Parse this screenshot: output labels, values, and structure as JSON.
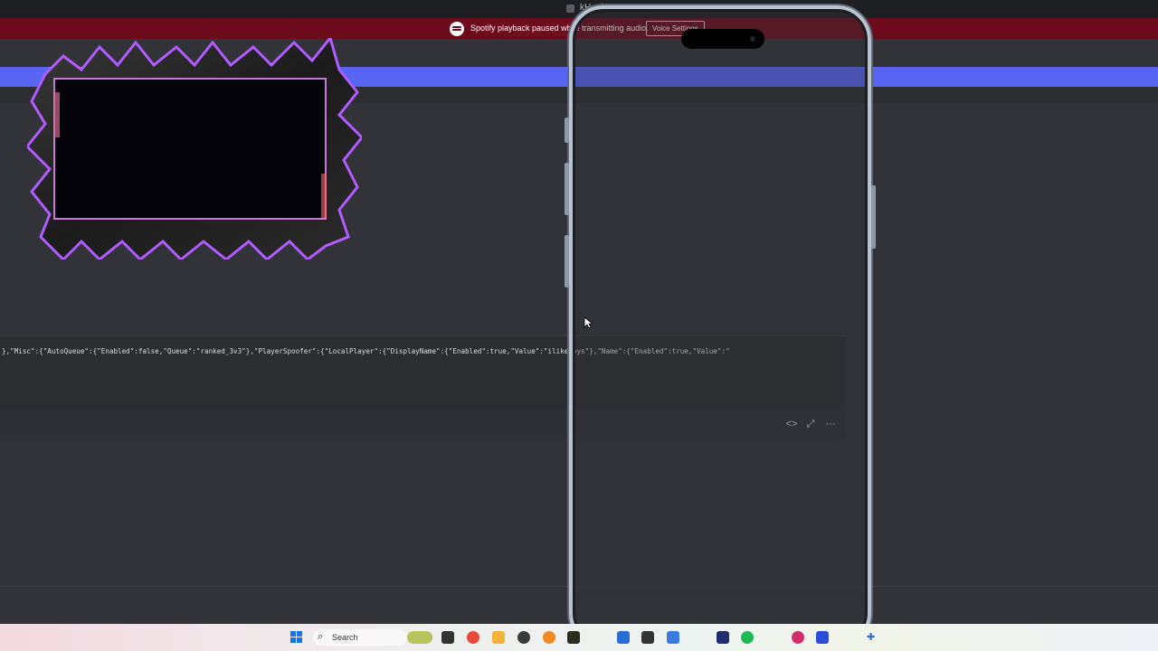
{
  "window": {
    "title": "kHook",
    "app_icon": "app-icon"
  },
  "notice": {
    "icon": "spotify-icon",
    "message": "Spotify playback paused while transmitting audio.",
    "button_label": "Voice Settings"
  },
  "message": {
    "code_text": "},\"Misc\":{\"AutoQueue\":{\"Enabled\":false,\"Queue\":\"ranked_3v3\"},\"PlayerSpoofer\":{\"LocalPlayer\":{\"DisplayName\":{\"Enabled\":true,\"Value\":\"ilikeboys\"},\"Name\":{\"Enabled\":true,\"Value\":\""
  },
  "embed_actions": [
    {
      "icon": "code-icon",
      "glyph": "<>"
    },
    {
      "icon": "expand-icon",
      "glyph": "⤢"
    },
    {
      "icon": "more-icon",
      "glyph": "···"
    }
  ],
  "taskbar": {
    "search_label": "Search",
    "search_icon": "search-icon",
    "apps": [
      "start-icon",
      "widgets-icon",
      "file-icon",
      "chrome-icon",
      "explorer-icon",
      "app-icon",
      "app-icon",
      "app-icon",
      "app-icon",
      "app-icon",
      "app-icon",
      "app-icon",
      "spotify-icon",
      "app-icon",
      "app-icon",
      "app-icon"
    ]
  },
  "colors": {
    "notice_bg": "#6b0b1c",
    "accent": "#5865f2",
    "bg": "#313338"
  }
}
